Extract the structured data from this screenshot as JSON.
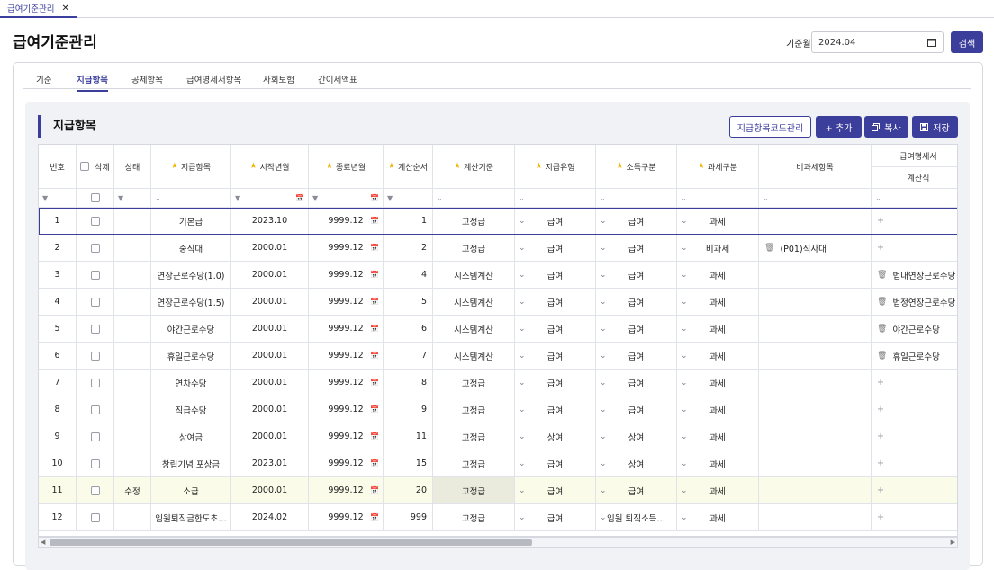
{
  "app_tab": {
    "label": "급여기준관리",
    "close": "✕"
  },
  "page_title": "급여기준관리",
  "base_month": {
    "label": "기준월",
    "value": "2024.04"
  },
  "search_button": "검색",
  "subtabs": [
    {
      "label": "기준",
      "active": false
    },
    {
      "label": "지급항목",
      "active": true
    },
    {
      "label": "공제항목",
      "active": false
    },
    {
      "label": "급여명세서항목",
      "active": false
    },
    {
      "label": "사회보험",
      "active": false
    },
    {
      "label": "간이세액표",
      "active": false
    }
  ],
  "section_title": "지급항목",
  "actions": {
    "code_mgmt": "지급항목코드관리",
    "add": "+ 추가",
    "copy": "복사",
    "save": "저장"
  },
  "columns": [
    {
      "key": "no",
      "label": "번호",
      "star": false
    },
    {
      "key": "del",
      "label": "삭제",
      "star": false
    },
    {
      "key": "status",
      "label": "상태",
      "star": false
    },
    {
      "key": "item",
      "label": "지급항목",
      "star": true
    },
    {
      "key": "start",
      "label": "시작년월",
      "star": true
    },
    {
      "key": "end",
      "label": "종료년월",
      "star": true
    },
    {
      "key": "order",
      "label": "계산순서",
      "star": true
    },
    {
      "key": "basis",
      "label": "계산기준",
      "star": true
    },
    {
      "key": "paytype",
      "label": "지급유형",
      "star": true
    },
    {
      "key": "income",
      "label": "소득구분",
      "star": true
    },
    {
      "key": "tax",
      "label": "과세구분",
      "star": true
    },
    {
      "key": "nontax",
      "label": "비과세항목",
      "star": false
    }
  ],
  "col_group": {
    "label": "급여명세서",
    "sub": "계산식"
  },
  "rows": [
    {
      "no": "1",
      "status": "",
      "item": "기본급",
      "start": "2023.10",
      "end": "9999.12",
      "order": "1",
      "basis": "고정급",
      "paytype": "급여",
      "income": "급여",
      "tax": "과세",
      "nontax": "",
      "formula": "+",
      "formula_trash": false
    },
    {
      "no": "2",
      "status": "",
      "item": "중식대",
      "start": "2000.01",
      "end": "9999.12",
      "order": "2",
      "basis": "고정급",
      "paytype": "급여",
      "income": "급여",
      "tax": "비과세",
      "nontax": "(P01)식사대",
      "formula": "+",
      "formula_trash": false
    },
    {
      "no": "3",
      "status": "",
      "item": "연장근로수당(1.0)",
      "start": "2000.01",
      "end": "9999.12",
      "order": "4",
      "basis": "시스템계산",
      "paytype": "급여",
      "income": "급여",
      "tax": "과세",
      "nontax": "",
      "formula": "법내연장근로수당",
      "formula_trash": true
    },
    {
      "no": "4",
      "status": "",
      "item": "연장근로수당(1.5)",
      "start": "2000.01",
      "end": "9999.12",
      "order": "5",
      "basis": "시스템계산",
      "paytype": "급여",
      "income": "급여",
      "tax": "과세",
      "nontax": "",
      "formula": "법정연장근로수당",
      "formula_trash": true
    },
    {
      "no": "5",
      "status": "",
      "item": "야간근로수당",
      "start": "2000.01",
      "end": "9999.12",
      "order": "6",
      "basis": "시스템계산",
      "paytype": "급여",
      "income": "급여",
      "tax": "과세",
      "nontax": "",
      "formula": "야간근로수당",
      "formula_trash": true
    },
    {
      "no": "6",
      "status": "",
      "item": "휴일근로수당",
      "start": "2000.01",
      "end": "9999.12",
      "order": "7",
      "basis": "시스템계산",
      "paytype": "급여",
      "income": "급여",
      "tax": "과세",
      "nontax": "",
      "formula": "휴일근로수당",
      "formula_trash": true
    },
    {
      "no": "7",
      "status": "",
      "item": "연차수당",
      "start": "2000.01",
      "end": "9999.12",
      "order": "8",
      "basis": "고정급",
      "paytype": "급여",
      "income": "급여",
      "tax": "과세",
      "nontax": "",
      "formula": "+",
      "formula_trash": false
    },
    {
      "no": "8",
      "status": "",
      "item": "직급수당",
      "start": "2000.01",
      "end": "9999.12",
      "order": "9",
      "basis": "고정급",
      "paytype": "급여",
      "income": "급여",
      "tax": "과세",
      "nontax": "",
      "formula": "+",
      "formula_trash": false
    },
    {
      "no": "9",
      "status": "",
      "item": "상여금",
      "start": "2000.01",
      "end": "9999.12",
      "order": "11",
      "basis": "고정급",
      "paytype": "상여",
      "income": "상여",
      "tax": "과세",
      "nontax": "",
      "formula": "+",
      "formula_trash": false
    },
    {
      "no": "10",
      "status": "",
      "item": "창립기념 포상금",
      "start": "2023.01",
      "end": "9999.12",
      "order": "15",
      "basis": "고정급",
      "paytype": "급여",
      "income": "상여",
      "tax": "과세",
      "nontax": "",
      "formula": "+",
      "formula_trash": false
    },
    {
      "no": "11",
      "status": "수정",
      "item": "소급",
      "start": "2000.01",
      "end": "9999.12",
      "order": "20",
      "basis": "고정급",
      "paytype": "급여",
      "income": "급여",
      "tax": "과세",
      "nontax": "",
      "formula": "+",
      "formula_trash": false
    },
    {
      "no": "12",
      "status": "",
      "item": "임원퇴직금한도초…",
      "start": "2024.02",
      "end": "9999.12",
      "order": "999",
      "basis": "고정급",
      "paytype": "급여",
      "income": "임원 퇴직소득…",
      "tax": "과세",
      "nontax": "",
      "formula": "+",
      "formula_trash": false
    }
  ],
  "colors": {
    "accent": "#3c3e9c",
    "star": "#f0b400",
    "edited_row": "#fbfbe9"
  }
}
